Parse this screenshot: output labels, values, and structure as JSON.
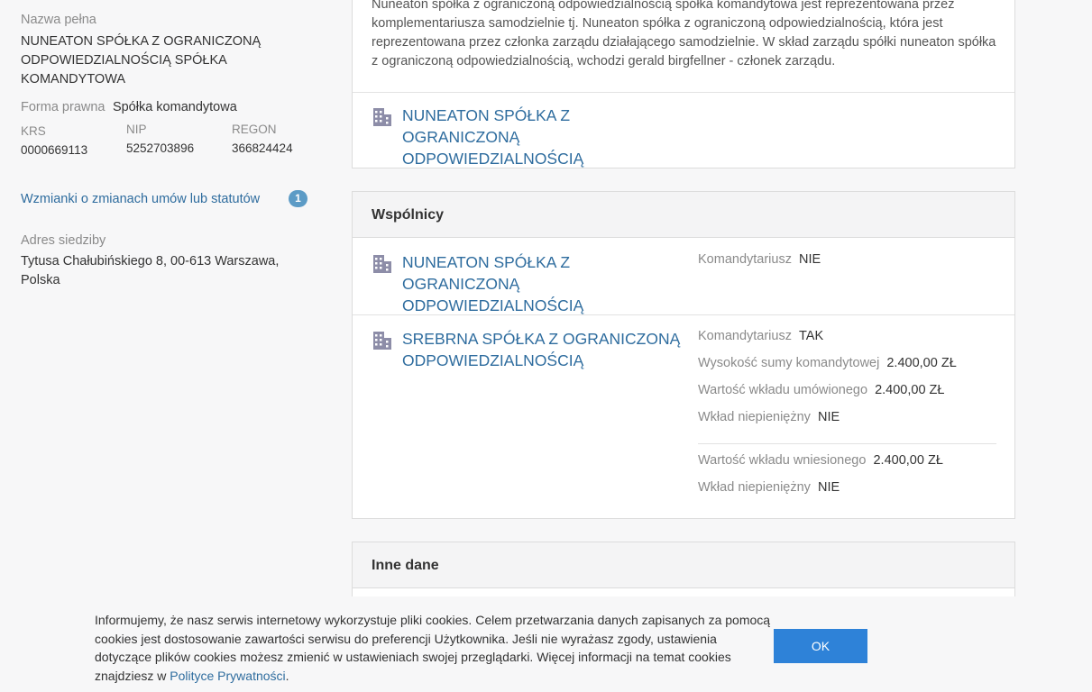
{
  "sidebar": {
    "name_label": "Nazwa pełna",
    "name_value": "NUNEATON SPÓŁKA Z OGRANICZONĄ ODPOWIEDZIALNOŚCIĄ SPÓŁKA KOMANDYTOWA",
    "forma_label": "Forma prawna",
    "forma_value": "Spółka komandytowa",
    "krs_label": "KRS",
    "krs_value": "0000669113",
    "nip_label": "NIP",
    "nip_value": "5252703896",
    "regon_label": "REGON",
    "regon_value": "366824424",
    "changes_link": "Wzmianki o zmianach umów lub statutów",
    "changes_count": "1",
    "address_label": "Adres siedziby",
    "address_value": "Tytusa Chałubińskiego 8, 00-613 Warszawa, Polska"
  },
  "representation": {
    "description": "Nuneaton spółka z ograniczoną odpowiedzialnością spółka komandytowa jest reprezentowana przez komplementariusza samodzielnie tj. Nuneaton spółka z ograniczoną odpowiedzialnością, która jest reprezentowana przez członka zarządu działającego samodzielnie. W skład zarządu spółki nuneaton spółka z ograniczoną odpowiedzialnością, wchodzi gerald birgfellner - członek zarządu.",
    "entity": "NUNEATON SPÓŁKA Z OGRANICZONĄ ODPOWIEDZIALNOŚCIĄ"
  },
  "partners": {
    "title": "Wspólnicy",
    "items": [
      {
        "name": "NUNEATON SPÓŁKA Z OGRANICZONĄ ODPOWIEDZIALNOŚCIĄ",
        "komandytariusz_label": "Komandytariusz",
        "komandytariusz_value": "NIE"
      },
      {
        "name": "SREBRNA SPÓŁKA Z OGRANICZONĄ ODPOWIEDZIALNOŚCIĄ",
        "komandytariusz_label": "Komandytariusz",
        "komandytariusz_value": "TAK",
        "suma_label": "Wysokość sumy komandytowej",
        "suma_value": "2.400,00 ZŁ",
        "umowiony_label": "Wartość wkładu umówionego",
        "umowiony_value": "2.400,00 ZŁ",
        "niepieniezny1_label": "Wkład niepieniężny",
        "niepieniezny1_value": "NIE",
        "wniesiony_label": "Wartość wkładu wniesionego",
        "wniesiony_value": "2.400,00 ZŁ",
        "niepieniezny2_label": "Wkład niepieniężny",
        "niepieniezny2_value": "NIE"
      }
    ]
  },
  "other": {
    "title": "Inne dane"
  },
  "cookie": {
    "text": "Informujemy, że nasz serwis internetowy wykorzystuje pliki cookies. Celem przetwarzania danych zapisanych za pomocą cookies jest dostosowanie zawartości serwisu do preferencji Użytkownika. Jeśli nie wyrażasz zgody, ustawienia dotyczące plików cookies możesz zmienić w ustawieniach swojej przeglądarki. Więcej informacji na temat cookies znajdziesz w ",
    "link": "Polityce Prywatności",
    "end": ".",
    "ok": "OK"
  },
  "colors": {
    "link": "#2e6c9e",
    "badge": "#5c9bc6",
    "button": "#2e82d8",
    "icon": "#8d8da8"
  }
}
